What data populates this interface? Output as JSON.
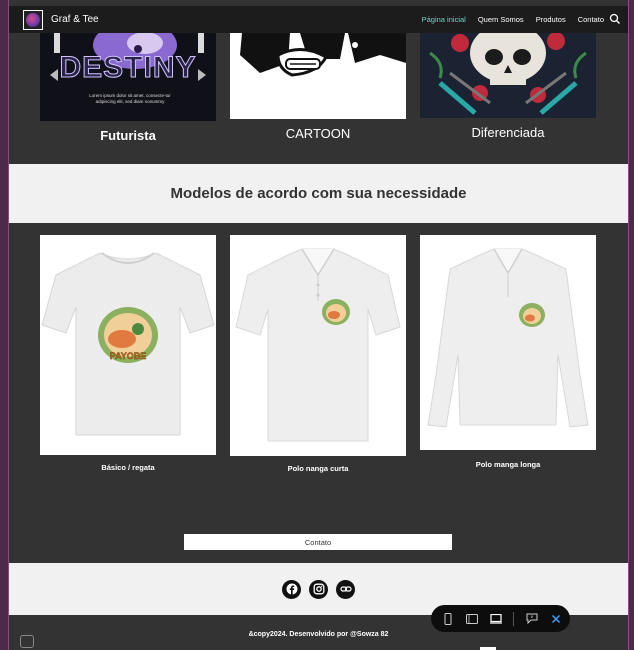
{
  "nav": {
    "brand": "Graf & Tee",
    "links": [
      "Página inicial",
      "Quem Somos",
      "Produtos",
      "Contato"
    ]
  },
  "top_cards": [
    {
      "label": "Futurista",
      "image_text": "DESTINY",
      "image_sub": "Lorem ipsum dolor sit amet, consecte-tur adipiscing elit, sed diam nonummy"
    },
    {
      "label": "CARTOON"
    },
    {
      "label": "Diferenciada"
    }
  ],
  "section": {
    "title": "Modelos de acordo com sua necessidade"
  },
  "shirts": [
    {
      "label": "Básico / regata"
    },
    {
      "label": "Polo nanga curta"
    },
    {
      "label": "Polo manga longa"
    }
  ],
  "contact_button": "Contato",
  "footer": {
    "copyright": "&copy2024. Desenvolvido por @Sowza 82"
  },
  "colors": {
    "accent": "#6fd3c5",
    "page_bg": "#333333",
    "band_bg": "#f1f1f1"
  }
}
